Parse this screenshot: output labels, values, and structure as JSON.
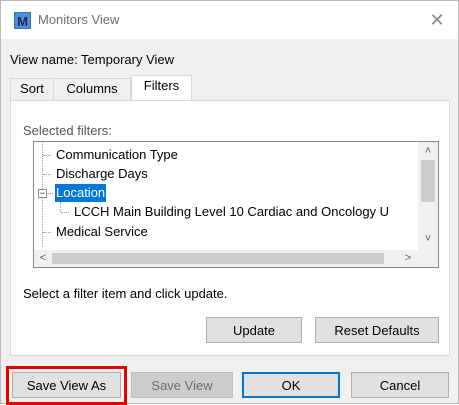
{
  "window": {
    "title": "Monitors View",
    "app_icon_letter": "M",
    "close_glyph": "✕"
  },
  "view_name_label": "View name: Temporary View",
  "tabs": [
    {
      "label": "Sort",
      "active": false
    },
    {
      "label": "Columns",
      "active": false
    },
    {
      "label": "Filters",
      "active": true
    }
  ],
  "filters": {
    "selected_label": "Selected filters:",
    "tree": [
      {
        "label": "Communication Type",
        "level": 0,
        "selected": false
      },
      {
        "label": "Discharge Days",
        "level": 0,
        "selected": false
      },
      {
        "label": "Location",
        "level": 0,
        "selected": true,
        "expanded": true,
        "expander": "−"
      },
      {
        "label": "LCCH Main Building Level 10 Cardiac and Oncology U",
        "level": 1,
        "selected": false
      },
      {
        "label": "Medical Service",
        "level": 0,
        "selected": false
      }
    ],
    "scroll_arrows": {
      "up": "˄",
      "down": "˅",
      "left": "<",
      "right": ">"
    },
    "instruction": "Select a filter item and click update.",
    "update_button": "Update",
    "reset_button": "Reset Defaults"
  },
  "footer": {
    "save_view_as": "Save View As",
    "save_view": "Save View",
    "ok": "OK",
    "cancel": "Cancel"
  },
  "colors": {
    "selection": "#0078d7",
    "highlight_box": "#e60000"
  }
}
